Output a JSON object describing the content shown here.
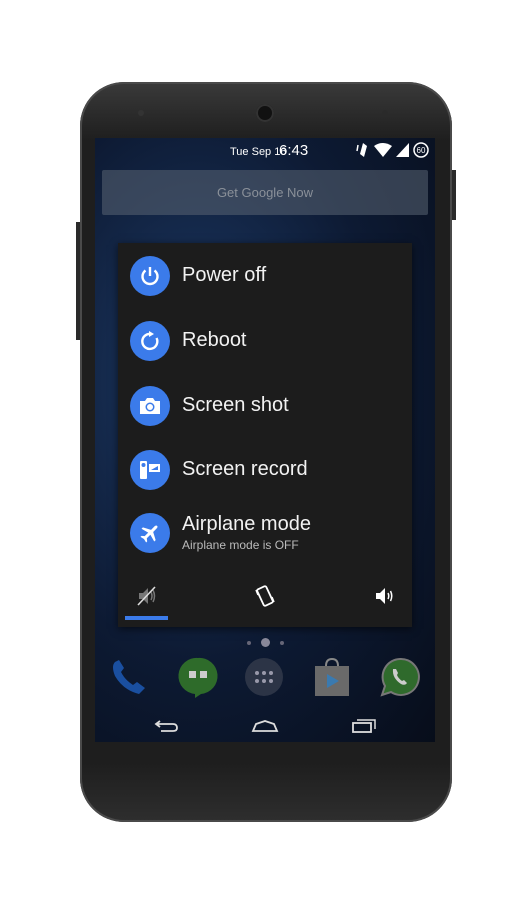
{
  "status_bar": {
    "date": "Tue Sep 16",
    "time": "6:43",
    "icons": [
      "vibrate-icon",
      "wifi-icon",
      "signal-icon",
      "battery-60-icon"
    ],
    "battery": "60"
  },
  "google_now": {
    "label": "Get Google Now"
  },
  "power_menu": {
    "accent": "#3b7bea",
    "items": [
      {
        "label": "Power off",
        "icon": "power-icon"
      },
      {
        "label": "Reboot",
        "icon": "reboot-icon"
      },
      {
        "label": "Screen shot",
        "icon": "camera-icon"
      },
      {
        "label": "Screen record",
        "icon": "screen-record-icon"
      },
      {
        "label": "Airplane mode",
        "sublabel": "Airplane mode is OFF",
        "icon": "airplane-icon"
      }
    ],
    "sound_modes": [
      "silent",
      "vibrate",
      "sound-on"
    ],
    "selected_sound_mode": "silent"
  },
  "home": {
    "page_count": 3,
    "current_page": 2,
    "dock": [
      "Phone",
      "Hangouts",
      "Apps",
      "Play Store",
      "WhatsApp"
    ]
  },
  "nav": [
    "back",
    "home",
    "recents"
  ]
}
